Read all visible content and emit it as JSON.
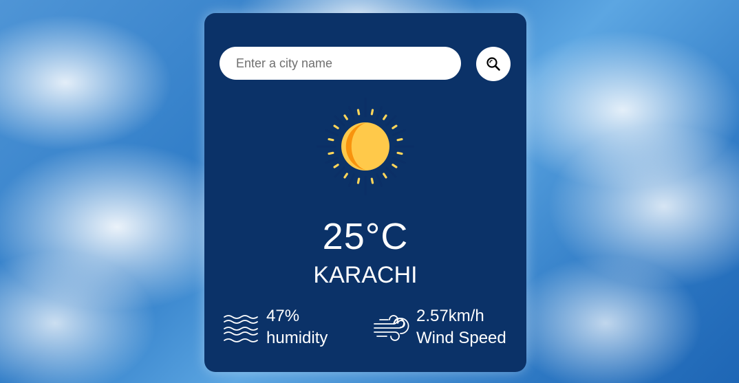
{
  "search": {
    "placeholder": "Enter a city name",
    "button_icon": "search-icon"
  },
  "weather": {
    "icon": "sun-icon",
    "temperature": "25°C",
    "city": "KARACHI"
  },
  "details": {
    "humidity": {
      "icon": "humidity-waves-icon",
      "value": "47%",
      "label": "humidity"
    },
    "wind": {
      "icon": "wind-icon",
      "value": "2.57km/h",
      "label": "Wind Speed"
    }
  },
  "colors": {
    "card_background": "#0b3268",
    "sun_core": "#ffc94a",
    "sun_shade": "#f8930e",
    "sun_rays_dark": "#0b2f66",
    "sun_rays_light": "#ffd65a",
    "text": "#ffffff"
  }
}
